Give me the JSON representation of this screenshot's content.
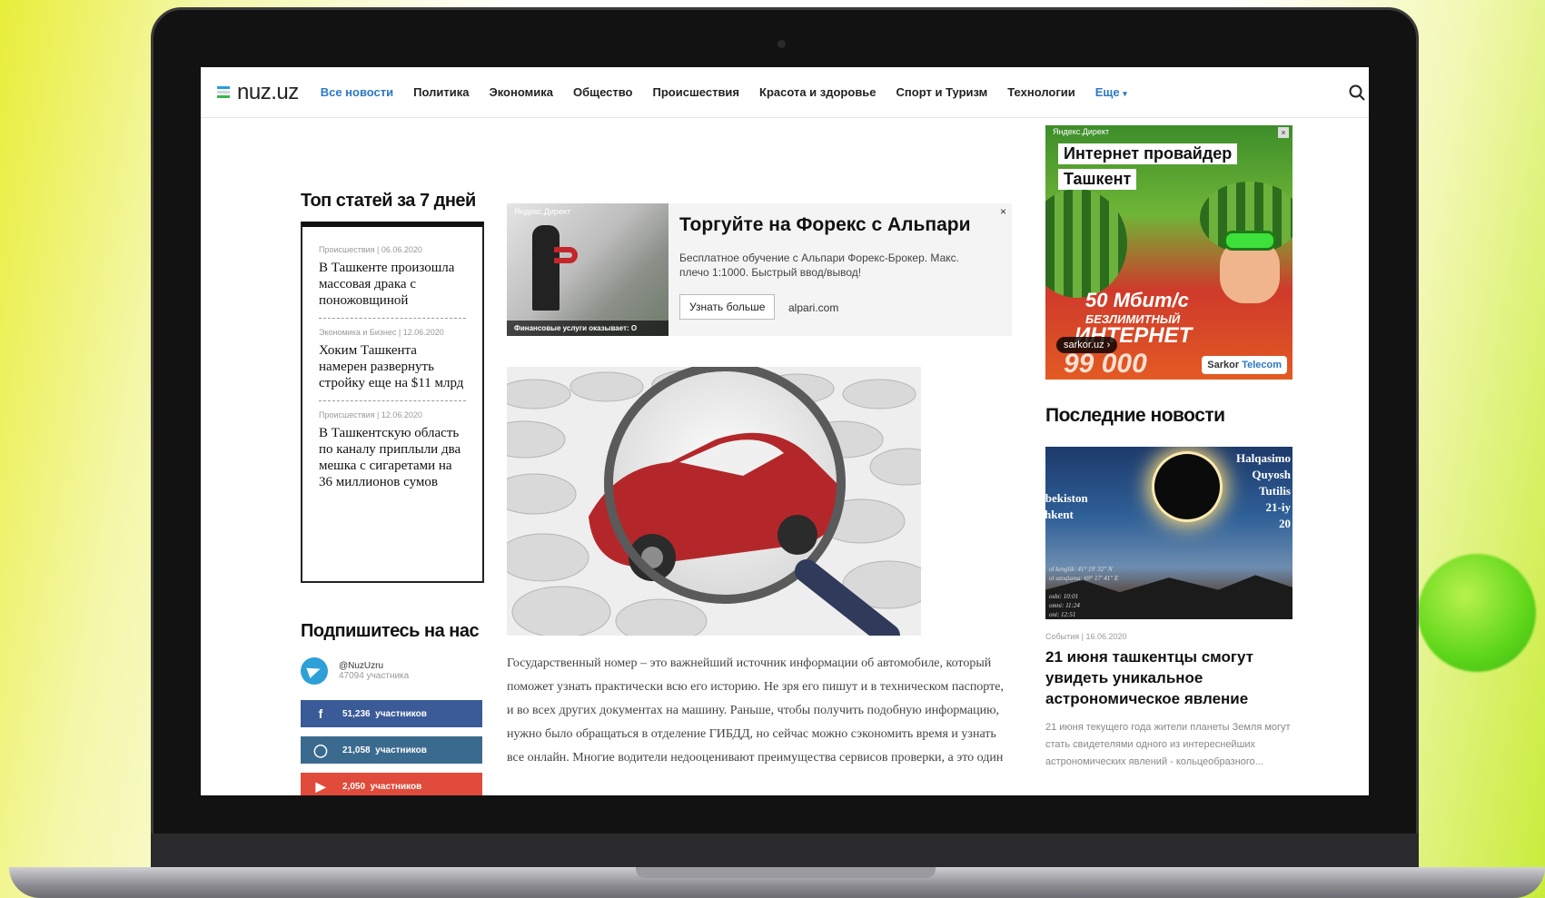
{
  "site": {
    "logo": "nuz.uz",
    "logo_colors": [
      "#2b9de0",
      "#ffffff",
      "#3ab54a"
    ]
  },
  "nav": {
    "items": [
      {
        "label": "Все новости",
        "active": true
      },
      {
        "label": "Политика",
        "active": false
      },
      {
        "label": "Экономика",
        "active": false
      },
      {
        "label": "Общество",
        "active": false
      },
      {
        "label": "Происшествия",
        "active": false
      },
      {
        "label": "Красота и здоровье",
        "active": false
      },
      {
        "label": "Спорт и Туризм",
        "active": false
      },
      {
        "label": "Технологии",
        "active": false
      }
    ],
    "more_label": "Еще",
    "accent_color": "#2b78c5"
  },
  "top_articles": {
    "heading": "Топ статей за 7 дней",
    "items": [
      {
        "category": "Происшествия",
        "date": "06.06.2020",
        "title": "В Ташкенте произошла массовая драка с поножовщиной"
      },
      {
        "category": "Экономика и Бизнес",
        "date": "12.06.2020",
        "title": "Хоким Ташкента намерен развернуть стройку еще на $11 млрд"
      },
      {
        "category": "Происшествия",
        "date": "12.06.2020",
        "title": "В Ташкентскую область по каналу приплыли два мешка с сигаретами на 36 миллионов сумов"
      }
    ]
  },
  "subscribe": {
    "heading": "Подпишитесь на нас",
    "telegram": {
      "name": "@NuzUzru",
      "count": "47094 участника"
    },
    "facebook": {
      "count": "51,236",
      "label": "участников"
    },
    "instagram": {
      "count": "21,058",
      "label": "участников"
    },
    "youtube": {
      "count": "2,050",
      "label": "участников"
    }
  },
  "ad_forex": {
    "label": "Яндекс.Директ",
    "image_caption": "Финансовые услуги оказывает: О",
    "title": "Торгуйте на Форекс с Альпари",
    "description": "Бесплатное обучение с Альпари Форекс-Брокер. Макс. плечо 1:1000. Быстрый ввод/вывод!",
    "button": "Узнать больше",
    "domain": "alpari.com",
    "close": "×"
  },
  "article": {
    "image_icon": "magnifier-car-icon",
    "body": "Государственный номер – это важнейший источник информации об автомобиле, который поможет узнать практически всю его историю. Не зря его пишут и в техническом паспорте, и во всех других документах на машину. Раньше, чтобы получить подобную информацию, нужно было обращаться в отделение ГИБДД, но сейчас можно сэкономить время и узнать все онлайн. Многие водители недооценивают преимущества сервисов проверки, а это один"
  },
  "ad_internet": {
    "label": "Яндекс.Директ",
    "line1": "Интернет провайдер",
    "line2": "Ташкент",
    "speed": "50 Мбит/с",
    "unlimited": "БЕЗЛИМИТНЫЙ",
    "internet": "ИНТЕРНЕТ",
    "price": "99 000",
    "site": "sarkor.uz ›",
    "brand_a": "Sarkor",
    "brand_b": "Telecom"
  },
  "latest": {
    "heading": "Последние новости",
    "image_text_left": [
      "zbekiston",
      "shkent"
    ],
    "image_text_right": [
      "Halqasimo",
      "Quyosh",
      "Tutilis",
      "21-iy",
      "20"
    ],
    "image_text_small": [
      "ol kenglik: 41° 19' 32\" N",
      "ol uzoqlama: 69° 17' 41\" E",
      "",
      "oshi: 10:01",
      "omni: 11:24",
      "oni: 12:51"
    ],
    "category": "События",
    "date": "16.06.2020",
    "title": "21 июня ташкентцы смогут увидеть уникальное астрономическое явление",
    "description": "21 июня текущего года жители планеты Земля могут стать свидетелями одного из интереснейших астрономических явлений - кольцеобразного..."
  }
}
